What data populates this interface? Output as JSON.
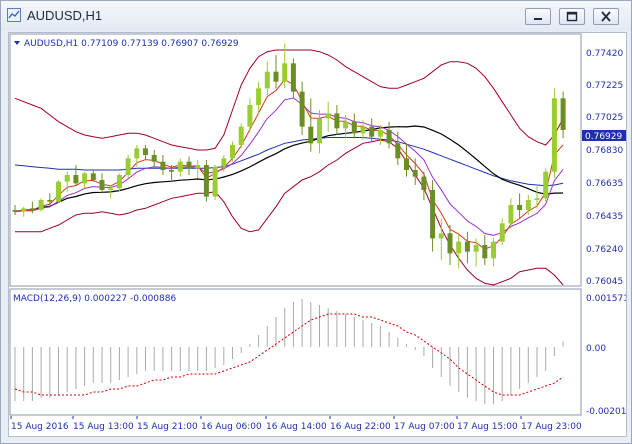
{
  "window": {
    "title": "AUDUSD,H1",
    "minimize_icon": "minimize-icon",
    "restore_icon": "restore-icon",
    "close_icon": "close-icon"
  },
  "main_chart": {
    "header": "AUDUSD,H1  0.77109 0.77139 0.76907 0.76929",
    "price_labels": [
      "0.77420",
      "0.77225",
      "0.77025",
      "0.76830",
      "0.76635",
      "0.76435",
      "0.76240",
      "0.76045"
    ],
    "current_price": "0.76929"
  },
  "macd": {
    "header": "MACD(12,26,9) 0.000227 -0.000886",
    "labels": [
      "0.001571",
      "0.00",
      "-0.002014"
    ]
  },
  "time_axis": {
    "labels": [
      "15 Aug 2016",
      "15 Aug 13:00",
      "15 Aug 21:00",
      "16 Aug 06:00",
      "16 Aug 14:00",
      "16 Aug 22:00",
      "17 Aug 07:00",
      "17 Aug 15:00",
      "17 Aug 23:00"
    ]
  },
  "colors": {
    "bull_candle": "#9acd32",
    "bear_candle": "#6b8e23",
    "bollinger": "#a0002a",
    "ma_black": "#000000",
    "ma_blue": "#1f2fb0",
    "ma_purple": "#9a30d0",
    "ma_red": "#d23a1a",
    "macd_hist": "#aaaaaa",
    "macd_signal": "#cc0000",
    "axis_text": "#1f2fb0"
  },
  "chart_data": {
    "type": "candlestick",
    "symbol": "AUDUSD",
    "timeframe": "H1",
    "ylim": [
      0.76,
      0.775
    ],
    "candles": [
      [
        0.7645,
        0.7648,
        0.7642,
        0.7644
      ],
      [
        0.7644,
        0.7647,
        0.7641,
        0.7646
      ],
      [
        0.7646,
        0.765,
        0.7643,
        0.7645
      ],
      [
        0.7645,
        0.7652,
        0.7644,
        0.7651
      ],
      [
        0.7651,
        0.7655,
        0.7648,
        0.765
      ],
      [
        0.765,
        0.7663,
        0.7649,
        0.7662
      ],
      [
        0.7662,
        0.7668,
        0.7656,
        0.7666
      ],
      [
        0.7666,
        0.7672,
        0.766,
        0.7661
      ],
      [
        0.7661,
        0.7668,
        0.7658,
        0.7667
      ],
      [
        0.7667,
        0.7669,
        0.7662,
        0.7663
      ],
      [
        0.7663,
        0.7667,
        0.7655,
        0.7657
      ],
      [
        0.7657,
        0.766,
        0.7652,
        0.7658
      ],
      [
        0.7658,
        0.7667,
        0.7656,
        0.7666
      ],
      [
        0.7666,
        0.7678,
        0.7664,
        0.7676
      ],
      [
        0.7676,
        0.7684,
        0.7671,
        0.7682
      ],
      [
        0.7682,
        0.7684,
        0.7675,
        0.7678
      ],
      [
        0.7678,
        0.7681,
        0.767,
        0.7674
      ],
      [
        0.7674,
        0.7678,
        0.7666,
        0.7669
      ],
      [
        0.7669,
        0.7672,
        0.7662,
        0.7668
      ],
      [
        0.7668,
        0.7676,
        0.7665,
        0.7674
      ],
      [
        0.7674,
        0.7677,
        0.7666,
        0.767
      ],
      [
        0.767,
        0.7675,
        0.7664,
        0.7672
      ],
      [
        0.7672,
        0.7675,
        0.765,
        0.7653
      ],
      [
        0.7653,
        0.7672,
        0.7651,
        0.7671
      ],
      [
        0.7671,
        0.7678,
        0.7668,
        0.7676
      ],
      [
        0.7676,
        0.7686,
        0.7674,
        0.7684
      ],
      [
        0.7684,
        0.7697,
        0.7682,
        0.7695
      ],
      [
        0.7695,
        0.7712,
        0.7692,
        0.7708
      ],
      [
        0.7708,
        0.7722,
        0.7702,
        0.7718
      ],
      [
        0.7718,
        0.7734,
        0.7714,
        0.7728
      ],
      [
        0.7728,
        0.7738,
        0.7718,
        0.7722
      ],
      [
        0.7722,
        0.7745,
        0.7718,
        0.7733
      ],
      [
        0.7733,
        0.7736,
        0.7712,
        0.7716
      ],
      [
        0.7716,
        0.7722,
        0.769,
        0.7695
      ],
      [
        0.7695,
        0.7712,
        0.768,
        0.7685
      ],
      [
        0.7685,
        0.7705,
        0.7679,
        0.77
      ],
      [
        0.77,
        0.771,
        0.7692,
        0.7703
      ],
      [
        0.7703,
        0.7708,
        0.769,
        0.7694
      ],
      [
        0.7694,
        0.7702,
        0.7688,
        0.7698
      ],
      [
        0.7698,
        0.7703,
        0.7688,
        0.7691
      ],
      [
        0.7691,
        0.7699,
        0.7687,
        0.7695
      ],
      [
        0.7695,
        0.77,
        0.7686,
        0.7689
      ],
      [
        0.7689,
        0.7696,
        0.7684,
        0.7693
      ],
      [
        0.7693,
        0.7698,
        0.7682,
        0.7685
      ],
      [
        0.7685,
        0.7692,
        0.7672,
        0.7676
      ],
      [
        0.7676,
        0.7685,
        0.7665,
        0.7669
      ],
      [
        0.7669,
        0.7676,
        0.766,
        0.7665
      ],
      [
        0.7665,
        0.7668,
        0.7651,
        0.7657
      ],
      [
        0.7657,
        0.7663,
        0.762,
        0.7628
      ],
      [
        0.7628,
        0.764,
        0.7615,
        0.7631
      ],
      [
        0.7631,
        0.7636,
        0.7612,
        0.7619
      ],
      [
        0.7619,
        0.763,
        0.761,
        0.7626
      ],
      [
        0.7626,
        0.7632,
        0.7613,
        0.762
      ],
      [
        0.762,
        0.7628,
        0.7611,
        0.7624
      ],
      [
        0.7624,
        0.763,
        0.7612,
        0.7616
      ],
      [
        0.7616,
        0.7628,
        0.7611,
        0.7626
      ],
      [
        0.7626,
        0.764,
        0.7624,
        0.7637
      ],
      [
        0.7637,
        0.7652,
        0.7634,
        0.7648
      ],
      [
        0.7648,
        0.7655,
        0.764,
        0.7645
      ],
      [
        0.7645,
        0.7654,
        0.7642,
        0.7651
      ],
      [
        0.7651,
        0.766,
        0.7646,
        0.7652
      ],
      [
        0.7652,
        0.767,
        0.765,
        0.7668
      ],
      [
        0.7668,
        0.7718,
        0.7664,
        0.7712
      ],
      [
        0.7712,
        0.7716,
        0.7688,
        0.7693
      ]
    ],
    "bollinger_upper": [
      0.7712,
      0.771,
      0.7708,
      0.7706,
      0.7702,
      0.7698,
      0.7695,
      0.7692,
      0.769,
      0.7689,
      0.7688,
      0.7689,
      0.769,
      0.7691,
      0.7691,
      0.769,
      0.7688,
      0.7686,
      0.7684,
      0.7683,
      0.7682,
      0.7681,
      0.7681,
      0.7682,
      0.769,
      0.7705,
      0.772,
      0.773,
      0.7737,
      0.774,
      0.7741,
      0.7741,
      0.7741,
      0.7741,
      0.7741,
      0.774,
      0.7738,
      0.7735,
      0.7731,
      0.7728,
      0.7725,
      0.7722,
      0.7719,
      0.7718,
      0.7718,
      0.772,
      0.7722,
      0.7724,
      0.7728,
      0.7732,
      0.7734,
      0.7734,
      0.7733,
      0.773,
      0.7725,
      0.7718,
      0.771,
      0.7702,
      0.7694,
      0.7689,
      0.7686,
      0.7684,
      0.769,
      0.77
    ],
    "bollinger_middle": [
      0.7672,
      0.7671,
      0.767,
      0.7669,
      0.7668,
      0.7667,
      0.7667,
      0.7667,
      0.7666,
      0.7666,
      0.7666,
      0.7666,
      0.7666,
      0.7667,
      0.7668,
      0.7668,
      0.7668,
      0.7668,
      0.7668,
      0.7668,
      0.7668,
      0.7668,
      0.7668,
      0.7669,
      0.767,
      0.7673,
      0.7677,
      0.7681,
      0.7685,
      0.769,
      0.7694,
      0.7698,
      0.77,
      0.7702,
      0.7703,
      0.7704,
      0.7705,
      0.7705,
      0.7705,
      0.7705,
      0.7705,
      0.7704,
      0.7703,
      0.7702,
      0.77,
      0.7697,
      0.7694,
      0.7691,
      0.7687,
      0.7683,
      0.7679,
      0.7675,
      0.7671,
      0.7667,
      0.7663,
      0.7659,
      0.7656,
      0.7653,
      0.7651,
      0.7649,
      0.7648,
      0.7647,
      0.7648,
      0.765
    ],
    "bollinger_lower": [
      0.7632,
      0.7632,
      0.7632,
      0.7632,
      0.7634,
      0.7636,
      0.7639,
      0.7642,
      0.7643,
      0.7643,
      0.7644,
      0.7643,
      0.7642,
      0.7643,
      0.7645,
      0.7646,
      0.7648,
      0.765,
      0.7652,
      0.7653,
      0.7654,
      0.7655,
      0.7655,
      0.7656,
      0.765,
      0.7641,
      0.7634,
      0.7632,
      0.7633,
      0.764,
      0.7647,
      0.7655,
      0.7659,
      0.7663,
      0.7665,
      0.7668,
      0.7672,
      0.7675,
      0.7679,
      0.7682,
      0.7685,
      0.7686,
      0.7687,
      0.7686,
      0.7682,
      0.7674,
      0.7666,
      0.7658,
      0.7646,
      0.7634,
      0.7624,
      0.7616,
      0.7609,
      0.7604,
      0.7601,
      0.76,
      0.7602,
      0.7604,
      0.7608,
      0.7609,
      0.761,
      0.761,
      0.7606,
      0.76
    ],
    "macd_histogram": [
      -0.0018,
      -0.0018,
      -0.0018,
      -0.0017,
      -0.0017,
      -0.0016,
      -0.0015,
      -0.0014,
      -0.0013,
      -0.0012,
      -0.0012,
      -0.0012,
      -0.0011,
      -0.001,
      -0.0009,
      -0.0008,
      -0.0008,
      -0.0008,
      -0.0008,
      -0.0008,
      -0.0008,
      -0.0008,
      -0.0008,
      -0.0007,
      -0.0006,
      -0.0004,
      -0.0002,
      0.0001,
      0.0004,
      0.0007,
      0.001,
      0.0013,
      0.0015,
      0.0016,
      0.0015,
      0.0014,
      0.0013,
      0.0012,
      0.0011,
      0.001,
      0.0009,
      0.0008,
      0.0007,
      0.0005,
      0.0003,
      0.0001,
      -0.0001,
      -0.0003,
      -0.0007,
      -0.001,
      -0.0013,
      -0.0015,
      -0.0017,
      -0.0018,
      -0.0019,
      -0.0019,
      -0.0018,
      -0.0016,
      -0.0014,
      -0.0012,
      -0.001,
      -0.0008,
      -0.0003,
      0.0002
    ],
    "macd_signal": [
      -0.0014,
      -0.0015,
      -0.0015,
      -0.0016,
      -0.0016,
      -0.0016,
      -0.0016,
      -0.0016,
      -0.0016,
      -0.0015,
      -0.0015,
      -0.0014,
      -0.0014,
      -0.0013,
      -0.0013,
      -0.0012,
      -0.0011,
      -0.0011,
      -0.001,
      -0.001,
      -0.0009,
      -0.0009,
      -0.0009,
      -0.0009,
      -0.0008,
      -0.0007,
      -0.0006,
      -0.0005,
      -0.0003,
      -0.0001,
      0.0001,
      0.0003,
      0.0005,
      0.0007,
      0.0009,
      0.001,
      0.0011,
      0.0011,
      0.0011,
      0.0011,
      0.001,
      0.001,
      0.0009,
      0.0008,
      0.0007,
      0.0005,
      0.0004,
      0.0002,
      0.0,
      -0.0002,
      -0.0004,
      -0.0007,
      -0.0009,
      -0.0011,
      -0.0013,
      -0.0015,
      -0.0016,
      -0.0016,
      -0.0016,
      -0.0015,
      -0.0014,
      -0.0013,
      -0.0012,
      -0.001
    ]
  }
}
